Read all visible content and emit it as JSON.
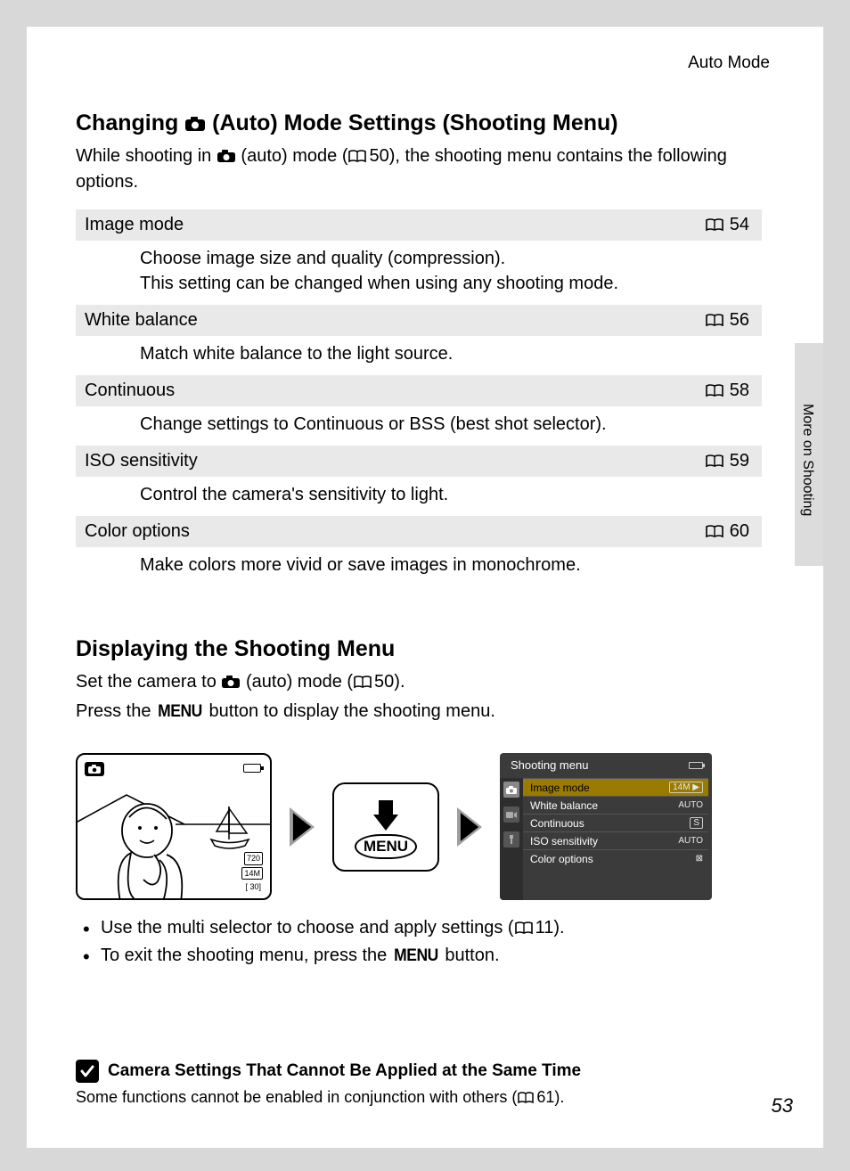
{
  "running_head": "Auto Mode",
  "side_tab": "More on Shooting",
  "page_number": "53",
  "head1_pre": "Changing ",
  "head1_post": " (Auto) Mode Settings (Shooting Menu)",
  "intro_pre": "While shooting in ",
  "intro_mid": " (auto) mode (",
  "intro_ref": "50",
  "intro_post": "), the shooting menu contains the following options.",
  "settings": [
    {
      "name": "Image mode",
      "page": "54",
      "desc": "Choose image size and quality (compression).\nThis setting can be changed when using any shooting mode."
    },
    {
      "name": "White balance",
      "page": "56",
      "desc": "Match white balance to the light source."
    },
    {
      "name": "Continuous",
      "page": "58",
      "desc": "Change settings to Continuous or BSS (best shot selector)."
    },
    {
      "name": "ISO sensitivity",
      "page": "59",
      "desc": "Control the camera's sensitivity to light."
    },
    {
      "name": "Color options",
      "page": "60",
      "desc": "Make colors more vivid or save images in monochrome."
    }
  ],
  "head2": "Displaying the Shooting Menu",
  "s2_line1_pre": "Set the camera to ",
  "s2_line1_mid": " (auto) mode (",
  "s2_line1_ref": "50",
  "s2_line1_post": ").",
  "s2_line2_pre": "Press the ",
  "s2_line2_menu": "MENU",
  "s2_line2_post": " button to display the shooting menu.",
  "lcd": {
    "info1": "720",
    "info2": "14M",
    "info3": "[   30]"
  },
  "menu_btn_label": "MENU",
  "shooting_menu": {
    "title": "Shooting menu",
    "items": [
      {
        "label": "Image mode",
        "value": "14M ▶",
        "selected": true
      },
      {
        "label": "White balance",
        "value": "AUTO"
      },
      {
        "label": "Continuous",
        "value": "S",
        "boxed": true
      },
      {
        "label": "ISO sensitivity",
        "value": "AUTO"
      },
      {
        "label": "Color options",
        "value": "⊠"
      }
    ]
  },
  "bullets": {
    "b1_pre": "Use the multi selector to choose and apply settings (",
    "b1_ref": "11",
    "b1_post": ").",
    "b2_pre": "To exit the shooting menu, press the ",
    "b2_menu": "MENU",
    "b2_post": " button."
  },
  "note": {
    "title": "Camera Settings That Cannot Be Applied at the Same Time",
    "body_pre": "Some functions cannot be enabled in conjunction with others (",
    "body_ref": "61",
    "body_post": ")."
  }
}
